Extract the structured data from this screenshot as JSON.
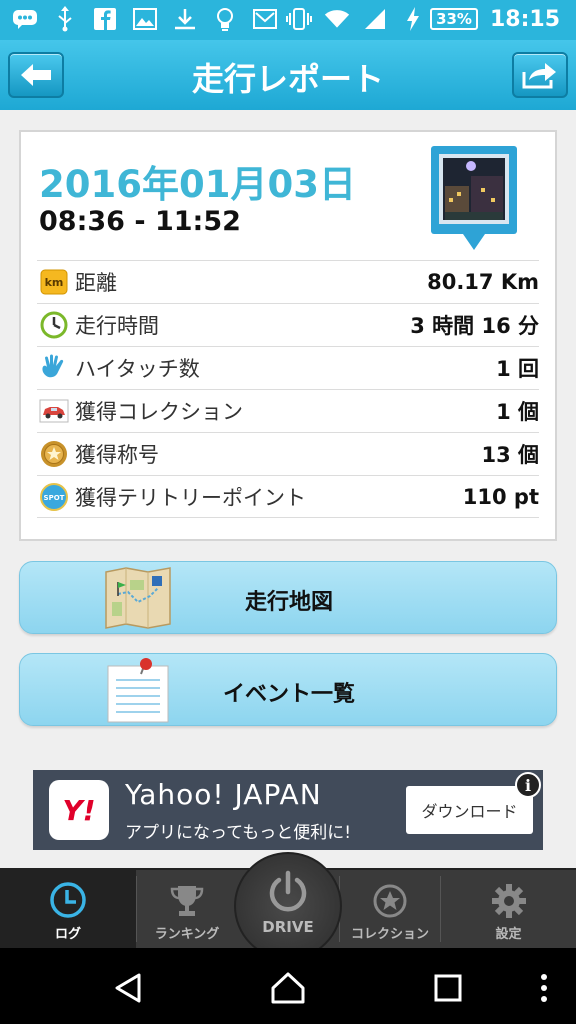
{
  "status_bar": {
    "battery": "33%",
    "time": "18:15",
    "icons": [
      "chat-icon",
      "usb-icon",
      "facebook-icon",
      "image-icon",
      "download-icon",
      "lightbulb-icon",
      "mail-icon",
      "vibrate-icon",
      "wifi-icon",
      "signal-icon",
      "charging-icon"
    ]
  },
  "header": {
    "title": "走行レポート",
    "back_icon": "back-arrow-icon",
    "share_icon": "share-icon"
  },
  "report": {
    "date": "2016年01月03日",
    "time_range": "08:36 - 11:52",
    "stats": [
      {
        "icon": "km-icon",
        "label": "距離",
        "value": "80.17 Km"
      },
      {
        "icon": "clock-icon",
        "label": "走行時間",
        "value": "3 時間 16 分"
      },
      {
        "icon": "high-five-icon",
        "label": "ハイタッチ数",
        "value": "1 回"
      },
      {
        "icon": "car-icon",
        "label": "獲得コレクション",
        "value": "1 個"
      },
      {
        "icon": "medal-icon",
        "label": "獲得称号",
        "value": "13 個"
      },
      {
        "icon": "spot-icon",
        "label": "獲得テリトリーポイント",
        "value": "110 pt"
      }
    ],
    "km_badge": "km",
    "spot_badge": "SPOT"
  },
  "buttons": {
    "map_label": "走行地図",
    "events_label": "イベント一覧"
  },
  "ad": {
    "logo_text": "Y!",
    "title": "Yahoo! JAPAN",
    "subtitle": "アプリになってもっと便利に!",
    "button": "ダウンロード",
    "info": "i"
  },
  "tabs": {
    "log": "ログ",
    "ranking": "ランキング",
    "drive": "DRIVE",
    "collection": "コレクション",
    "settings": "設定"
  },
  "colors": {
    "accent": "#2bb5dc",
    "date_text": "#3fb6d6",
    "active_tab_icon": "#3ab4e6"
  }
}
